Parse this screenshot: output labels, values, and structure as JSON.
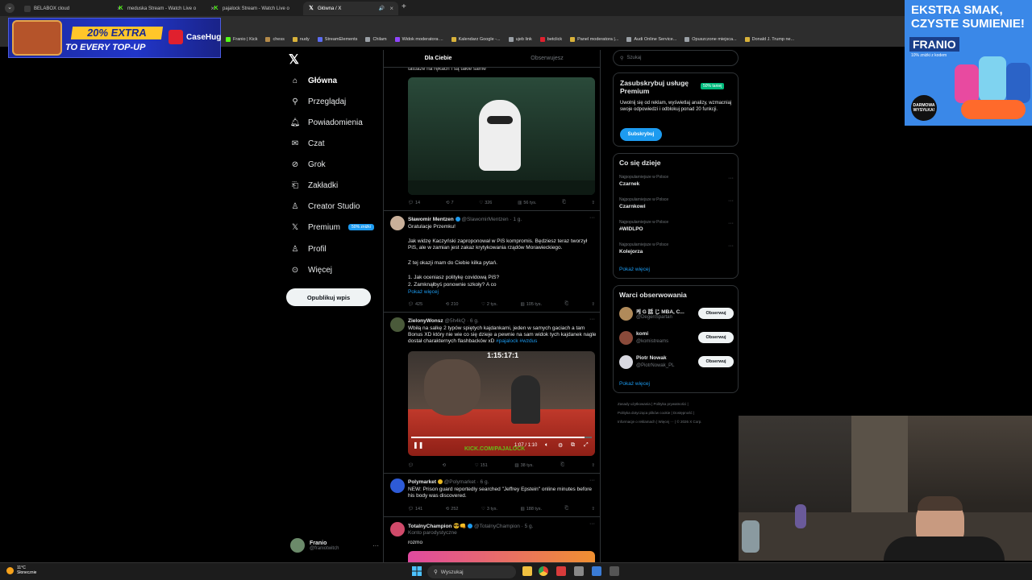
{
  "browser": {
    "tabs": [
      {
        "title": "BELABOX cloud",
        "icon": "page-icon",
        "active": false
      },
      {
        "title": "meduska Stream - Watch Live o",
        "icon": "kick-icon",
        "active": false
      },
      {
        "title": "pajalock Stream - Watch Live o",
        "icon": "kick-icon",
        "active": false
      },
      {
        "title": "Główna / X",
        "icon": "x-icon",
        "active": true
      }
    ],
    "bookmarks": [
      "Franio | Kick",
      "chess",
      "nudy",
      "StreamElements",
      "Chilam",
      "Widok moderatora ...",
      "Kalendarz Google -...",
      "ujeb link",
      "betclick",
      "Panel moderatora |...",
      "Audi Online Service...",
      "Opuszczone miejsca...",
      "Donald J. Trump ne..."
    ]
  },
  "ads": {
    "left": {
      "headline": "20% EXTRA",
      "sub": "TO EVERY TOP-UP",
      "brand": "CaseHug"
    },
    "right": {
      "headline": "EKSTRA SMAK, CZYSTE SUMIENIE!",
      "brand": "FRANIO",
      "tagline": "10% zniżki z kodem",
      "badge": "DARMOWA WYSYŁKA!"
    }
  },
  "nav": {
    "items": [
      {
        "label": "Główna",
        "icon": "home-icon"
      },
      {
        "label": "Przeglądaj",
        "icon": "search-icon"
      },
      {
        "label": "Powiadomienia",
        "icon": "bell-icon"
      },
      {
        "label": "Czat",
        "icon": "mail-icon"
      },
      {
        "label": "Grok",
        "icon": "grok-icon"
      },
      {
        "label": "Zakładki",
        "icon": "bookmark-icon"
      },
      {
        "label": "Creator Studio",
        "icon": "creator-icon"
      },
      {
        "label": "Premium",
        "icon": "x-icon"
      },
      {
        "label": "Profil",
        "icon": "person-icon"
      },
      {
        "label": "Więcej",
        "icon": "more-icon"
      }
    ],
    "premium_badge": "50% zniżki",
    "post_button": "Opublikuj wpis",
    "profile": {
      "name": "Franio",
      "handle": "@franiotwitch"
    }
  },
  "timeline": {
    "tabs": [
      "Dla Ciebie",
      "Obserwujesz"
    ],
    "partial_text": "tatuaże na rękach i są takie same",
    "tweet0_metrics": [
      "14",
      "7",
      "326",
      "56 tys."
    ],
    "tweets": [
      {
        "name": "Sławomir Mentzen",
        "handle": "@SlawomirMentzen · 1 g.",
        "lines": [
          "Gratulacje Przemku!",
          "Jak widzę Kaczyński zaproponował w PiS kompromis. Będziesz teraz tworzył PiS, ale w zamian jest zakaz krytykowania rządów Morawieckiego.",
          "Z tej okazji mam do Ciebie kilka pytań.",
          "1. Jak oceniasz politykę covidową PiS?",
          "2. Zamknąłbyś ponownie szkoły? A co"
        ],
        "show_more": "Pokaż więcej",
        "metrics": [
          "425",
          "210",
          "2 tys.",
          "105 tys."
        ]
      },
      {
        "name": "ZielonyWonsz",
        "handle": "@5h4kQ · 6 g.",
        "text": "Wbiłą na salkę 2 typów spiętych kajdankami, jeden w samych gaciach a tam Bonus XD który nie wie co się dzieje a pewnie na sam widok tych kajdanek nagle dostał charakternych flashbacków xD ",
        "tags": "#pajalock #wzdus",
        "video_time": "1:07 / 1:10",
        "video_timer": "1:15:17:1",
        "video_watermark": "KICK.COM/PAJALOCK",
        "metrics": [
          "",
          "",
          "151",
          "38 tys."
        ]
      },
      {
        "name": "Polymarket",
        "handle": "@Polymarket · 6 g.",
        "text": "NEW: Prison guard reportedly searched \"Jeffrey Epstein\" online minutes before his body was discovered.",
        "metrics": [
          "141",
          "252",
          "3 tys.",
          "188 tys."
        ]
      },
      {
        "name": "TotalnyChampion 😎👊",
        "handle": "@TotalnyChampion · 5 g.",
        "label": "Konto parodystyczne",
        "text": "rozmo"
      }
    ]
  },
  "sidebar": {
    "search_placeholder": "Szukaj",
    "subscribe": {
      "title": "Zasubskrybuj usługę Premium",
      "tag": "50% taniej",
      "text": "Uwolnij się od reklam, wyświetlaj analizy, wzmacniaj swoje odpowiedzi i odblokuj ponad 20 funkcji.",
      "button": "Subskrybuj"
    },
    "trends_title": "Co się dzieje",
    "trends": [
      {
        "context": "Najpopularniejsze w Polsce",
        "name": "Czarnek"
      },
      {
        "context": "Najpopularniejsze w Polsce",
        "name": "Czarnkowi"
      },
      {
        "context": "Najpopularniejsze w Polsce",
        "name": "#WIDLPO"
      },
      {
        "context": "Najpopularniejsze w Polsce",
        "name": "Kolejorza"
      }
    ],
    "show_more": "Pokaż więcej",
    "follow_title": "Warci obserwowania",
    "follow": [
      {
        "name": "케 G 話 じ MBA, C...",
        "handle": "@DegenSpartan"
      },
      {
        "name": "komi",
        "handle": "@komistreams"
      },
      {
        "name": "Piotr Nowak",
        "handle": "@PiotrNowak_PL"
      }
    ],
    "follow_button": "Obserwuj",
    "footer": [
      "Zasady użytkowania",
      "Polityka prywatności",
      "Polityka dotycząca plików cookie",
      "Dostępność",
      "Informacje o reklamach",
      "Więcej ···",
      "© 2026 X Corp."
    ]
  },
  "taskbar": {
    "temp": "11°C",
    "weather": "Słonecznie",
    "search": "Wyszukaj"
  }
}
